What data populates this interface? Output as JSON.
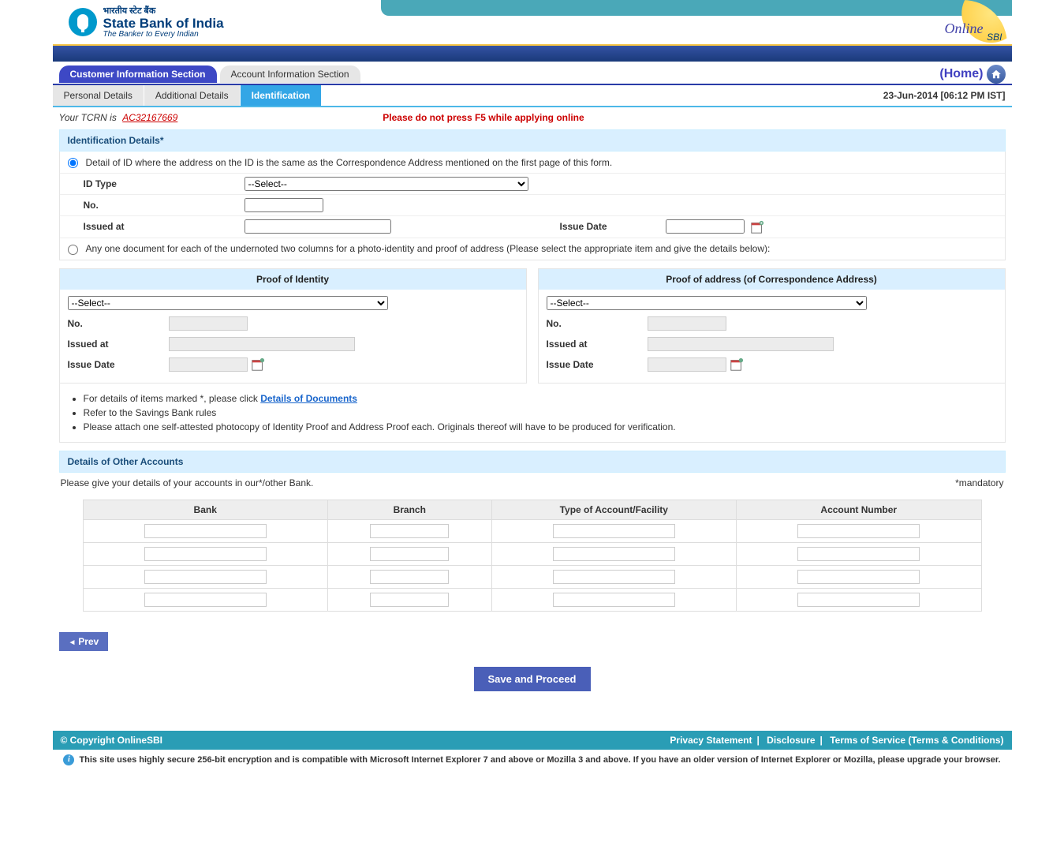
{
  "header": {
    "bank_hindi": "भारतीय स्टेट बैंक",
    "bank_name": "State Bank of India",
    "tagline": "The Banker to Every Indian",
    "online": "Online",
    "sbi": "SBI"
  },
  "sections": {
    "customer": "Customer Information Section",
    "account": "Account Information Section",
    "home_label": "(Home)"
  },
  "subtabs": {
    "personal": "Personal Details",
    "additional": "Additional Details",
    "identification": "Identification",
    "datetime": "23-Jun-2014 [06:12 PM IST]"
  },
  "tcrn": {
    "label": "Your TCRN is",
    "value": "AC32167669",
    "warning": "Please do not press F5 while applying online"
  },
  "identification": {
    "header": "Identification Details*",
    "opt1_text": "Detail of ID where the address on the ID is the same as the Correspondence Address mentioned on the first page of this form.",
    "opt2_text": "Any one document for each of the undernoted two columns for a photo-identity and proof of address (Please select the appropriate item  and give the details below):",
    "id_type_label": "ID Type",
    "id_type_value": "--Select--",
    "no_label": "No.",
    "issued_at_label": "Issued at",
    "issue_date_label": "Issue Date"
  },
  "proof": {
    "identity_header": "Proof of Identity",
    "address_header": "Proof of address (of Correspondence Address)",
    "select_value": "--Select--",
    "no_label": "No.",
    "issued_at_label": "Issued at",
    "issue_date_label": "Issue Date"
  },
  "bullets": {
    "b1_pre": "For details of items marked *, please click ",
    "b1_link": "Details of Documents",
    "b2": "Refer to the Savings Bank rules",
    "b3": "Please attach one self-attested photocopy of Identity Proof and Address Proof each. Originals thereof will have to be produced for verification."
  },
  "other_accounts": {
    "header": "Details of Other Accounts",
    "note": "Please give your details of your accounts in our*/other Bank.",
    "mandatory": "*mandatory",
    "cols": {
      "bank": "Bank",
      "branch": "Branch",
      "type": "Type of Account/Facility",
      "acctno": "Account Number"
    }
  },
  "buttons": {
    "prev": "Prev",
    "save": "Save and Proceed"
  },
  "footer": {
    "copyright": "© Copyright OnlineSBI",
    "privacy": "Privacy Statement",
    "disclosure": "Disclosure",
    "tos": "Terms of Service (Terms & Conditions)",
    "compat": "This site uses highly secure 256-bit encryption and is compatible with Microsoft Internet Explorer 7 and above or Mozilla 3 and above. If you have an older version of Internet Explorer or Mozilla, please upgrade your browser."
  }
}
